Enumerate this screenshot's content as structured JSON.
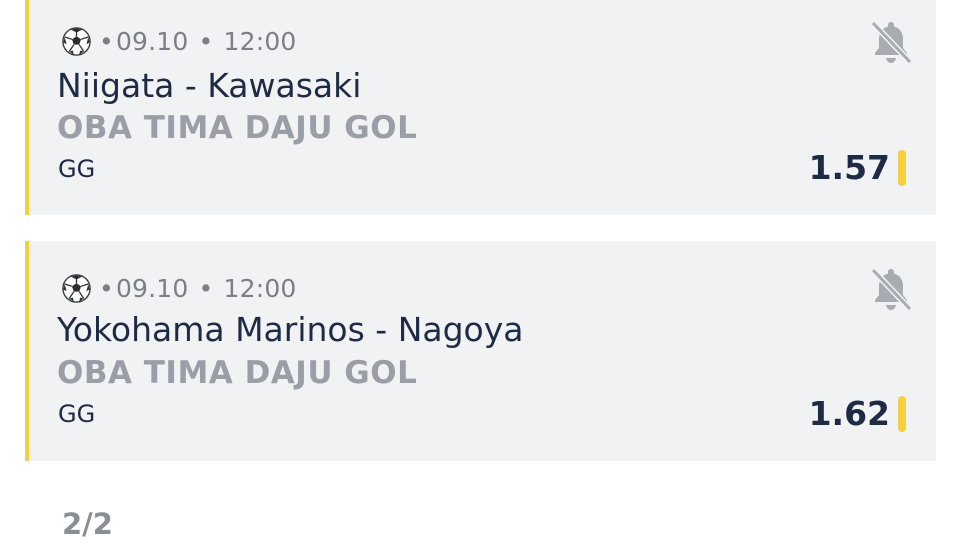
{
  "bets": [
    {
      "sport_icon": "soccer-ball-icon",
      "date": "09.10",
      "time": "12:00",
      "match": "Niigata - Kawasaki",
      "market": "OBA TIMA DAJU GOL",
      "selection": "GG",
      "odds": "1.57",
      "notification_icon": "bell-off-icon"
    },
    {
      "sport_icon": "soccer-ball-icon",
      "date": "09.10",
      "time": "12:00",
      "match": "Yokohama Marinos - Nagoya",
      "market": "OBA TIMA DAJU GOL",
      "selection": "GG",
      "odds": "1.62",
      "notification_icon": "bell-off-icon"
    }
  ],
  "pagination": "2/2",
  "colors": {
    "accent": "#f7cf3a",
    "card_bg": "#f1f2f4",
    "text_primary": "#1f2a44",
    "text_muted": "#9a9ea6"
  }
}
